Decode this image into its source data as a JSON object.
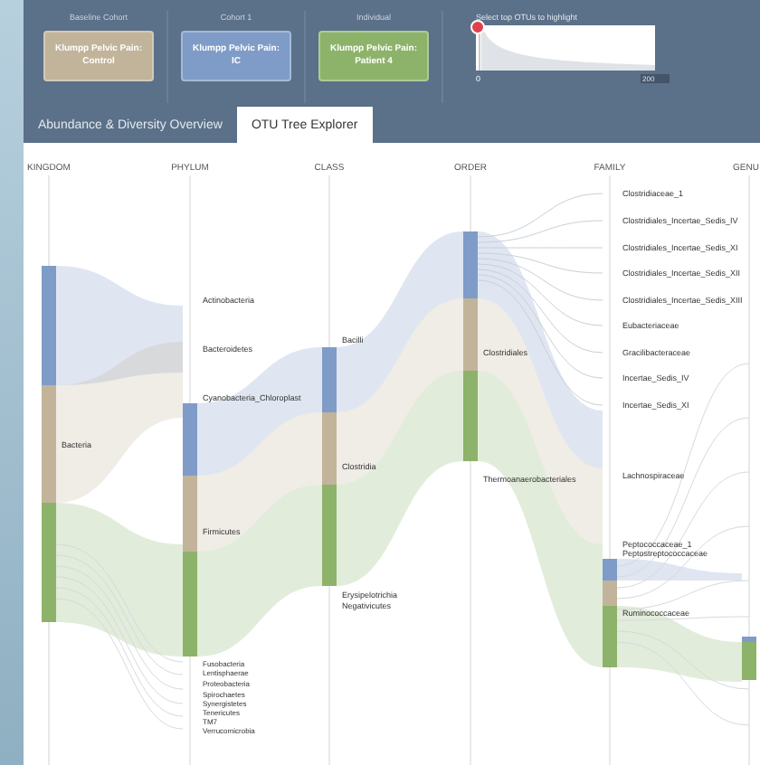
{
  "cohorts": [
    {
      "label": "Baseline Cohort",
      "button": "Klumpp Pelvic Pain: Control",
      "color": "#c2b49a"
    },
    {
      "label": "Cohort 1",
      "button": "Klumpp Pelvic Pain: IC",
      "color": "#7f9cc8"
    },
    {
      "label": "Individual",
      "button": "Klumpp Pelvic Pain: Patient 4",
      "color": "#8db36a"
    }
  ],
  "otu_selector": {
    "label": "Select top OTUs to highlight",
    "min_label": "0",
    "count": "200"
  },
  "tabs": [
    {
      "label": "Abundance & Diversity Overview",
      "selected": false
    },
    {
      "label": "OTU Tree Explorer",
      "selected": true
    }
  ],
  "sankey": {
    "columns": [
      {
        "header": "KINGDOM",
        "labels": [
          "Bacteria"
        ]
      },
      {
        "header": "PHYLUM",
        "labels": [
          "Actinobacteria",
          "Bacteroidetes",
          "Cyanobacteria_Chloroplast",
          "Firmicutes",
          "Fusobacteria",
          "Lentisphaerae",
          "Proteobacteria",
          "Spirochaetes",
          "Synergistetes",
          "Tenericutes",
          "TM7",
          "Verrucomicrobia"
        ]
      },
      {
        "header": "CLASS",
        "labels": [
          "Bacilli",
          "Clostridia",
          "Erysipelotrichia",
          "Negativicutes"
        ]
      },
      {
        "header": "ORDER",
        "labels": [
          "Clostridiales",
          "Thermoanaerobacteriales"
        ]
      },
      {
        "header": "FAMILY",
        "labels": [
          "Clostridiaceae_1",
          "Clostridiales_Incertae_Sedis_IV",
          "Clostridiales_Incertae_Sedis_XI",
          "Clostridiales_Incertae_Sedis_XII",
          "Clostridiales_Incertae_Sedis_XIII",
          "Eubacteriaceae",
          "Gracilibacteraceae",
          "Incertae_Sedis_IV",
          "Incertae_Sedis_XI",
          "Lachnospiraceae",
          "Peptococcaceae_1",
          "Peptostreptococcaceae",
          "Ruminococcaceae"
        ]
      },
      {
        "header": "GENU"
      }
    ]
  }
}
